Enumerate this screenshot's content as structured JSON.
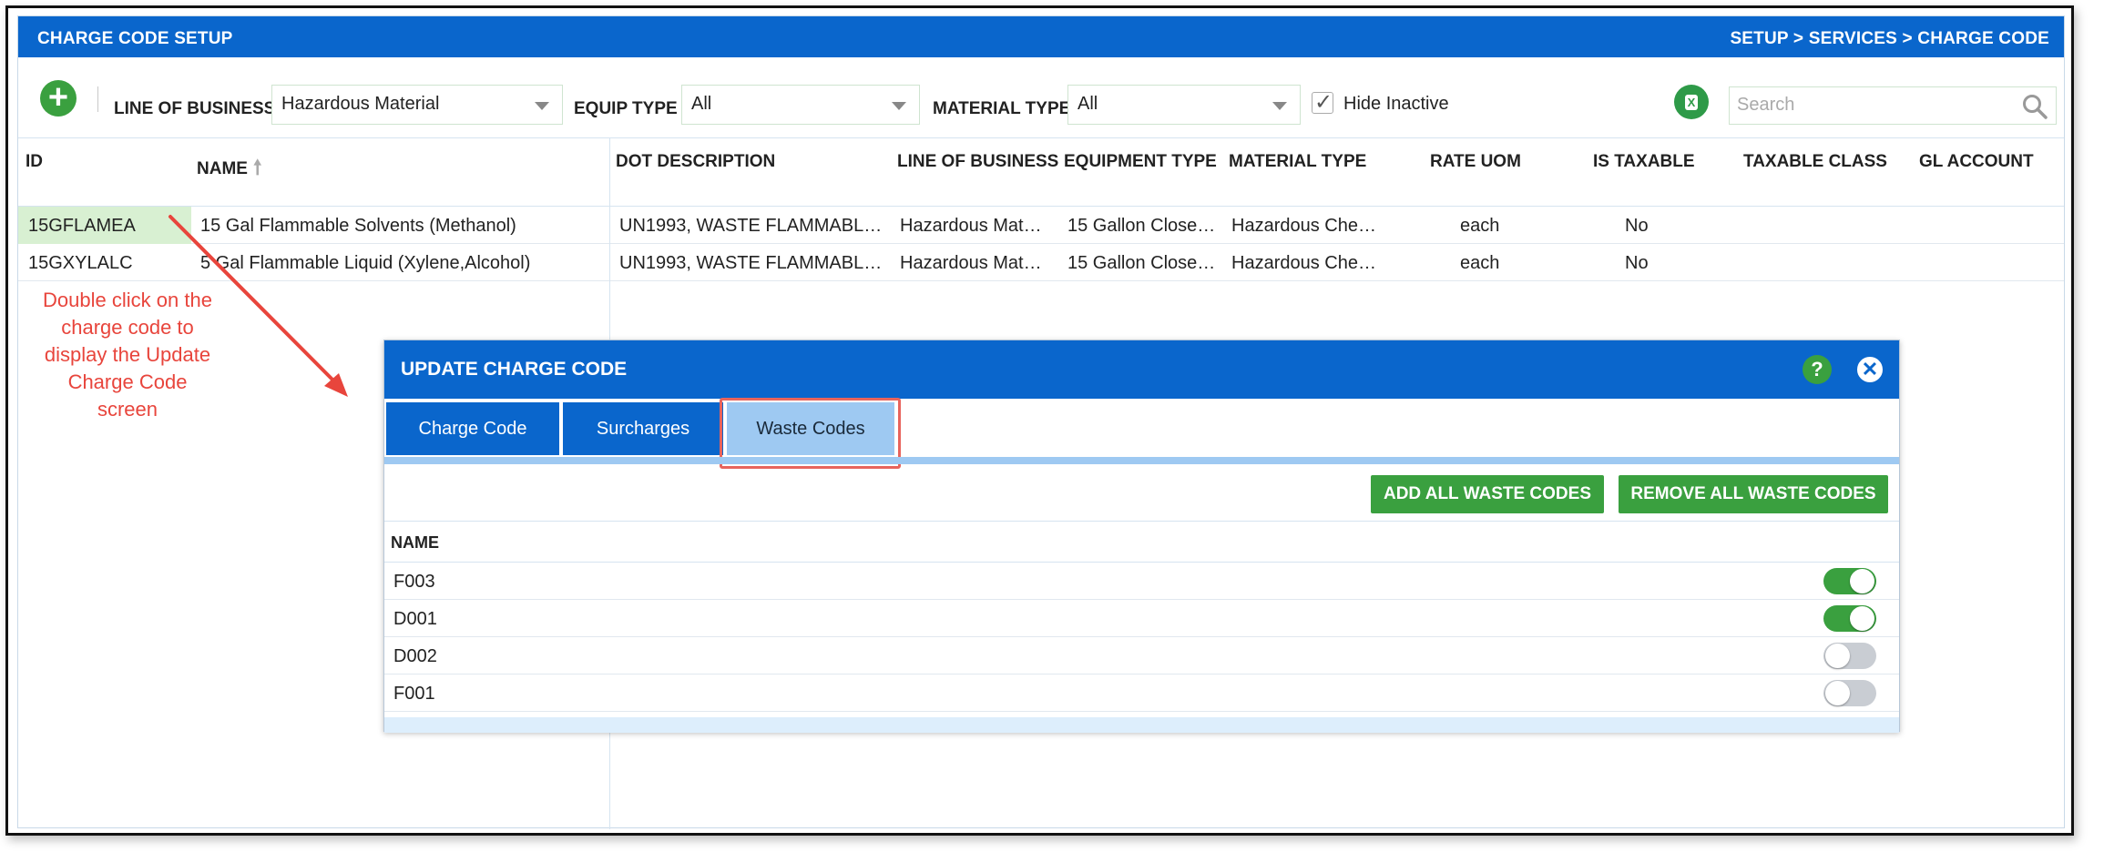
{
  "header": {
    "title": "CHARGE CODE SETUP",
    "breadcrumb": "SETUP > SERVICES > CHARGE CODE"
  },
  "filters": {
    "add_label": "+",
    "line_of_business_label": "LINE OF BUSINESS",
    "line_of_business_value": "Hazardous Material",
    "equip_type_label": "EQUIP TYPE",
    "equip_type_value": "All",
    "material_type_label": "MATERIAL TYPE",
    "material_type_value": "All",
    "hide_inactive_label": "Hide Inactive",
    "hide_inactive_checked": true,
    "excel_label": "X",
    "search_placeholder": "Search"
  },
  "grid": {
    "columns": [
      "ID",
      "NAME",
      "DOT DESCRIPTION",
      "LINE OF BUSINESS",
      "EQUIPMENT TYPE",
      "MATERIAL TYPE",
      "RATE UOM",
      "IS TAXABLE",
      "TAXABLE CLASS",
      "GL ACCOUNT"
    ],
    "rows": [
      {
        "id": "15GFLAMEA",
        "name": "15 Gal Flammable Solvents (Methanol)",
        "dot": "UN1993, WASTE FLAMMABL…",
        "lob": "Hazardous Mat…",
        "equip": "15 Gallon Close…",
        "material": "Hazardous Che…",
        "uom": "each",
        "taxable": "No"
      },
      {
        "id": "15GXYLALC",
        "name": "5 Gal Flammable Liquid (Xylene,Alcohol)",
        "dot": "UN1993, WASTE FLAMMABL…",
        "lob": "Hazardous Mat…",
        "equip": "15 Gallon Close…",
        "material": "Hazardous Che…",
        "uom": "each",
        "taxable": "No"
      }
    ]
  },
  "annotation": {
    "lines": [
      "Double click on the",
      "charge code to",
      "display the Update",
      "Charge Code",
      "screen"
    ],
    "color": "#e8453c"
  },
  "modal": {
    "title": "UPDATE CHARGE CODE",
    "help_label": "?",
    "close_label": "✕",
    "tabs": [
      "Charge Code",
      "Surcharges",
      "Waste Codes"
    ],
    "active_tab": "Waste Codes",
    "add_all_label": "ADD ALL WASTE CODES",
    "remove_all_label": "REMOVE ALL WASTE CODES",
    "table_header": "NAME",
    "waste_codes": [
      {
        "code": "F003",
        "enabled": true
      },
      {
        "code": "D001",
        "enabled": true
      },
      {
        "code": "D002",
        "enabled": false
      },
      {
        "code": "F001",
        "enabled": false
      }
    ]
  },
  "colors": {
    "brand_blue": "#0a66cc",
    "success_green": "#3aa03f",
    "active_tab": "#9ec9f2"
  }
}
